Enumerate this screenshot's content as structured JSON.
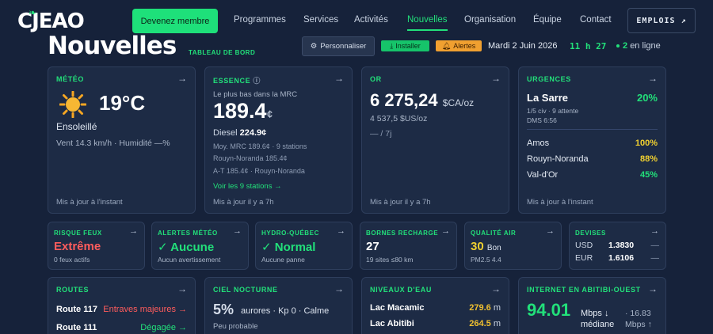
{
  "nav": {
    "logo": "CJEAO",
    "member_label": "Devenez membre",
    "links": [
      "Programmes",
      "Services",
      "Activités",
      "Nouvelles",
      "Organisation",
      "Équipe",
      "Contact"
    ],
    "active_link": "Nouvelles",
    "emplois_label": "EMPLOIS ↗"
  },
  "header": {
    "title": "Nouvelles",
    "subtitle": "TABLEAU DE BORD",
    "personaliser_label": "Personnaliser",
    "install_label": "Installer",
    "alerts_label": "Alertes",
    "date": "Mardi 2 Juin 2026",
    "clock": "11 h 27",
    "online_count": "2",
    "online_label": "en ligne"
  },
  "cards": {
    "meteo": {
      "title": "MÉTÉO",
      "temp": "19°C",
      "condition": "Ensoleillé",
      "details": "Vent 14.3 km/h · Humidité —%",
      "footer": "Mis à jour à l'instant"
    },
    "essence": {
      "title": "ESSENCE",
      "sub": "Le plus bas dans la MRC",
      "price": "189.4",
      "unit": "¢",
      "diesel_label": "Diesel",
      "diesel_value": "224.9¢",
      "s1": "Moy. MRC 189.6¢ · 9 stations",
      "s2": "Rouyn-Noranda 185.4¢",
      "s3": "A-T 185.4¢ · Rouyn-Noranda",
      "link": "Voir les 9 stations →",
      "footer": "Mis à jour il y a 7h"
    },
    "or": {
      "title": "OR",
      "price": "6 275,24",
      "unit": "$CA/oz",
      "usd": "4 537,5 $US/oz",
      "change": "— / 7j",
      "footer": "Mis à jour il y a 7h"
    },
    "urgences": {
      "title": "URGENCES",
      "main_name": "La Sarre",
      "main_value": "20%",
      "line1": "1/5 civ · 9 attente",
      "line2": "DMS 6:56",
      "rows": [
        {
          "name": "Amos",
          "value": "100%",
          "color": "#f0d030"
        },
        {
          "name": "Rouyn-Noranda",
          "value": "88%",
          "color": "#f0d030"
        },
        {
          "name": "Val-d'Or",
          "value": "45%",
          "color": "#22e07a"
        }
      ],
      "footer": "Mis à jour à l'instant"
    }
  },
  "mini": {
    "feux": {
      "title": "RISQUE FEUX",
      "value": "Extrême",
      "sub": "0 feux actifs",
      "color": "#ff5c5c"
    },
    "alertes": {
      "title": "ALERTES MÉTÉO",
      "value": "✓ Aucune",
      "sub": "Aucun avertissement",
      "color": "#22e07a"
    },
    "hydro": {
      "title": "HYDRO-QUÉBEC",
      "value": "✓ Normal",
      "sub": "Aucune panne",
      "color": "#22e07a"
    },
    "bornes": {
      "title": "BORNES RECHARGE",
      "value": "27",
      "sub": "19 sites ≤80 km",
      "color": "#ffffff"
    },
    "air": {
      "title": "QUALITÉ AIR",
      "value": "30",
      "value_label": "Bon",
      "sub": "PM2.5 4.4",
      "color": "#f0d030"
    },
    "devises": {
      "title": "DEVISES",
      "rows": [
        {
          "code": "USD",
          "value": "1.3830",
          "change": "—"
        },
        {
          "code": "EUR",
          "value": "1.6106",
          "change": "—"
        }
      ]
    }
  },
  "bottom": {
    "routes": {
      "title": "ROUTES",
      "rows": [
        {
          "name": "Route 117",
          "status": "Entraves majeures →",
          "tone": "red"
        },
        {
          "name": "Route 111",
          "status": "Dégagée →",
          "tone": "green"
        }
      ]
    },
    "ciel": {
      "title": "CIEL NOCTURNE",
      "value": "5%",
      "text": "aurores · Kp 0 · Calme",
      "sub": "Peu probable"
    },
    "eau": {
      "title": "NIVEAUX D'EAU",
      "rows": [
        {
          "name": "Lac Macamic",
          "value": "279.6",
          "unit": "m"
        },
        {
          "name": "Lac Abitibi",
          "value": "264.5",
          "unit": "m"
        }
      ]
    },
    "internet": {
      "title": "INTERNET EN ABITIBI-OUEST",
      "value": "94.01",
      "unit": "Mbps ↓",
      "unit2": "médiane",
      "up": "16.83",
      "up_unit": "Mbps ↑"
    }
  }
}
